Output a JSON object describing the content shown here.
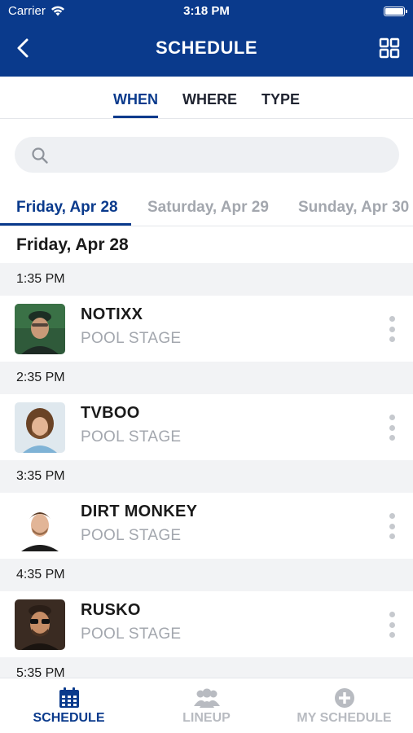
{
  "status_bar": {
    "carrier": "Carrier",
    "time": "3:18 PM"
  },
  "nav": {
    "title": "SCHEDULE"
  },
  "filter_tabs": [
    {
      "label": "WHEN",
      "active": true
    },
    {
      "label": "WHERE",
      "active": false
    },
    {
      "label": "TYPE",
      "active": false
    }
  ],
  "search": {
    "placeholder": ""
  },
  "day_tabs": [
    {
      "label": "Friday, Apr 28",
      "active": true
    },
    {
      "label": "Saturday, Apr 29",
      "active": false
    },
    {
      "label": "Sunday, Apr 30",
      "active": false
    }
  ],
  "day_heading": "Friday, Apr 28",
  "schedule": [
    {
      "time": "1:35 PM",
      "artist": "NOTIXX",
      "stage": "POOL STAGE"
    },
    {
      "time": "2:35 PM",
      "artist": "TVBOO",
      "stage": "POOL STAGE"
    },
    {
      "time": "3:35 PM",
      "artist": "DIRT MONKEY",
      "stage": "POOL STAGE"
    },
    {
      "time": "4:35 PM",
      "artist": "RUSKO",
      "stage": "POOL STAGE"
    },
    {
      "time": "5:35 PM",
      "artist": "",
      "stage": ""
    }
  ],
  "tab_bar": [
    {
      "label": "SCHEDULE",
      "icon": "calendar-icon",
      "active": true
    },
    {
      "label": "LINEUP",
      "icon": "group-icon",
      "active": false
    },
    {
      "label": "MY SCHEDULE",
      "icon": "plus-circle-icon",
      "active": false
    }
  ],
  "colors": {
    "brand": "#0a3a8c",
    "muted": "#a3a7ae",
    "section_bg": "#f2f3f5"
  }
}
